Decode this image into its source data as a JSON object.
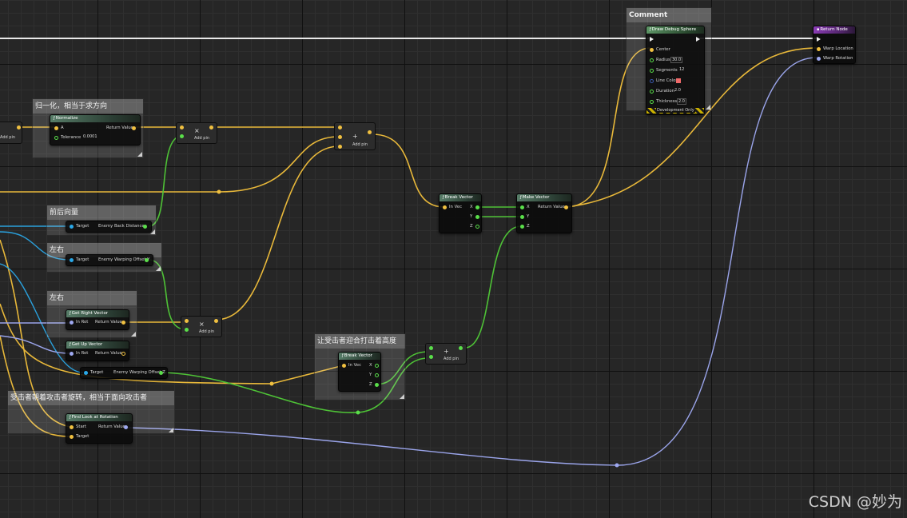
{
  "colors": {
    "exec": "#f0f0f0",
    "vector": "#f0c040",
    "rotator": "#9ea8f0",
    "object": "#2aa8e8",
    "float": "#5ade4a",
    "linear_color": "#3a5ab0"
  },
  "comments": {
    "c_normalize": "归一化，相当于求方向",
    "c_forward": "前后向量",
    "c_lr1": "左右",
    "c_lr2": "左右",
    "c_height": "让受击者迎合打击着高度",
    "c_rotate": "受击者朝着攻击者旋转，相当于面向攻击者",
    "c_comment": "Comment"
  },
  "nodes": {
    "normalize": {
      "title": "Normalize",
      "pin_a": "A",
      "pin_tol": "Tolerance",
      "tol_val": "0.0001",
      "ret": "Return Value"
    },
    "mult1": {
      "op": "×",
      "addpin": "Add pin"
    },
    "add1": {
      "op": "+",
      "addpin": "Add pin"
    },
    "mult2": {
      "op": "×",
      "addpin": "Add pin"
    },
    "add2": {
      "op": "+",
      "addpin": "Add pin"
    },
    "left_addpin": "Add pin",
    "enemy_back": {
      "target": "Target",
      "ret": "Enemy Back Distance"
    },
    "enemy_warp_y": {
      "target": "Target",
      "ret": "Enemy Warping Offset Y"
    },
    "get_right": {
      "title": "Get Right Vector",
      "in": "In Rot",
      "ret": "Return Value"
    },
    "get_up": {
      "title": "Get Up Vector",
      "in": "In Rot",
      "ret": "Return Value"
    },
    "enemy_warp_z": {
      "target": "Target",
      "ret": "Enemy Warping Offset Z"
    },
    "break1": {
      "title": "Break Vector",
      "in": "In Vec",
      "x": "X",
      "y": "Y",
      "z": "Z"
    },
    "make": {
      "title": "Make Vector",
      "x": "X",
      "y": "Y",
      "z": "Z",
      "ret": "Return Value"
    },
    "break2": {
      "title": "Break Vector",
      "in": "In Vec",
      "x": "X",
      "y": "Y",
      "z": "Z"
    },
    "find_look": {
      "title": "Find Look at Rotation",
      "start": "Start",
      "target": "Target",
      "ret": "Return Value"
    },
    "debug_sphere": {
      "title": "Draw Debug Sphere",
      "center": "Center",
      "radius": "Radius",
      "radius_val": "30.0",
      "segments": "Segments",
      "segments_val": "12",
      "line_color": "Line Color",
      "duration": "Duration",
      "duration_val": "2.0",
      "thickness": "Thickness",
      "thickness_val": "2.0",
      "dev_only": "Development Only"
    },
    "return_node": {
      "title": "Return Node",
      "warp_loc": "Warp Location",
      "warp_rot": "Warp Rotation"
    }
  },
  "watermark": "CSDN @妙为"
}
